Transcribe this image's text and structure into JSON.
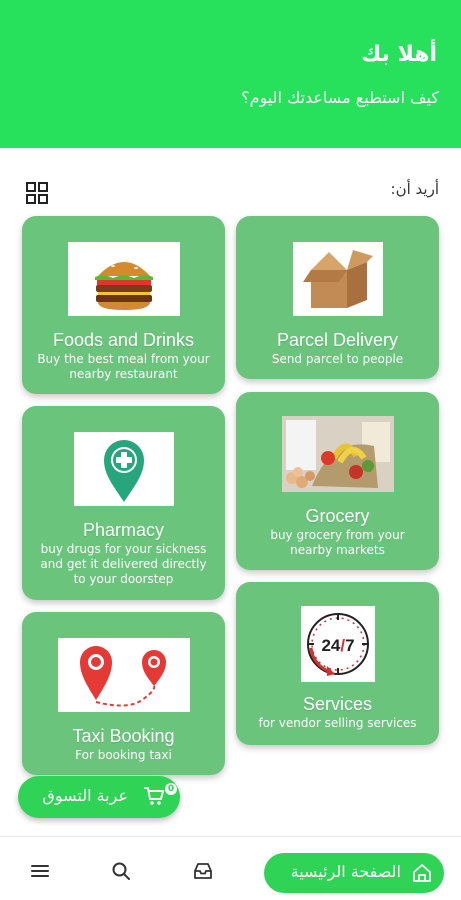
{
  "header": {
    "greeting": "أهلا بك",
    "subtitle": "كيف استطيع مساعدتك اليوم؟"
  },
  "section": {
    "label": "أريد أن:",
    "toggle_icon": "grid-icon"
  },
  "services": [
    {
      "title": "Foods and Drinks",
      "description": "Buy the best meal from your nearby restaurant",
      "image": "burger-image"
    },
    {
      "title": "Parcel Delivery",
      "description": "Send parcel to people",
      "image": "box-image"
    },
    {
      "title": "Pharmacy",
      "description": "buy drugs for your sickness and get it delivered directly to your doorstep",
      "image": "pharmacy-pin-image"
    },
    {
      "title": "Grocery",
      "description": "buy grocery from your nearby markets",
      "image": "grocery-image"
    },
    {
      "title": "Taxi Booking",
      "description": "For booking taxi",
      "image": "route-pins-image"
    },
    {
      "title": "Services",
      "description": "for vendor selling services",
      "image": "24-7-clock-image"
    }
  ],
  "cart": {
    "label": "عربة التسوق",
    "count": "0",
    "icon": "cart-icon"
  },
  "bottom_nav": {
    "home_label": "الصفحة الرئيسية",
    "icons": [
      "menu-icon",
      "search-icon",
      "inbox-icon",
      "home-icon"
    ]
  },
  "colors": {
    "header": "#27e05c",
    "card": "#6ac47c",
    "button": "#2fd355"
  }
}
